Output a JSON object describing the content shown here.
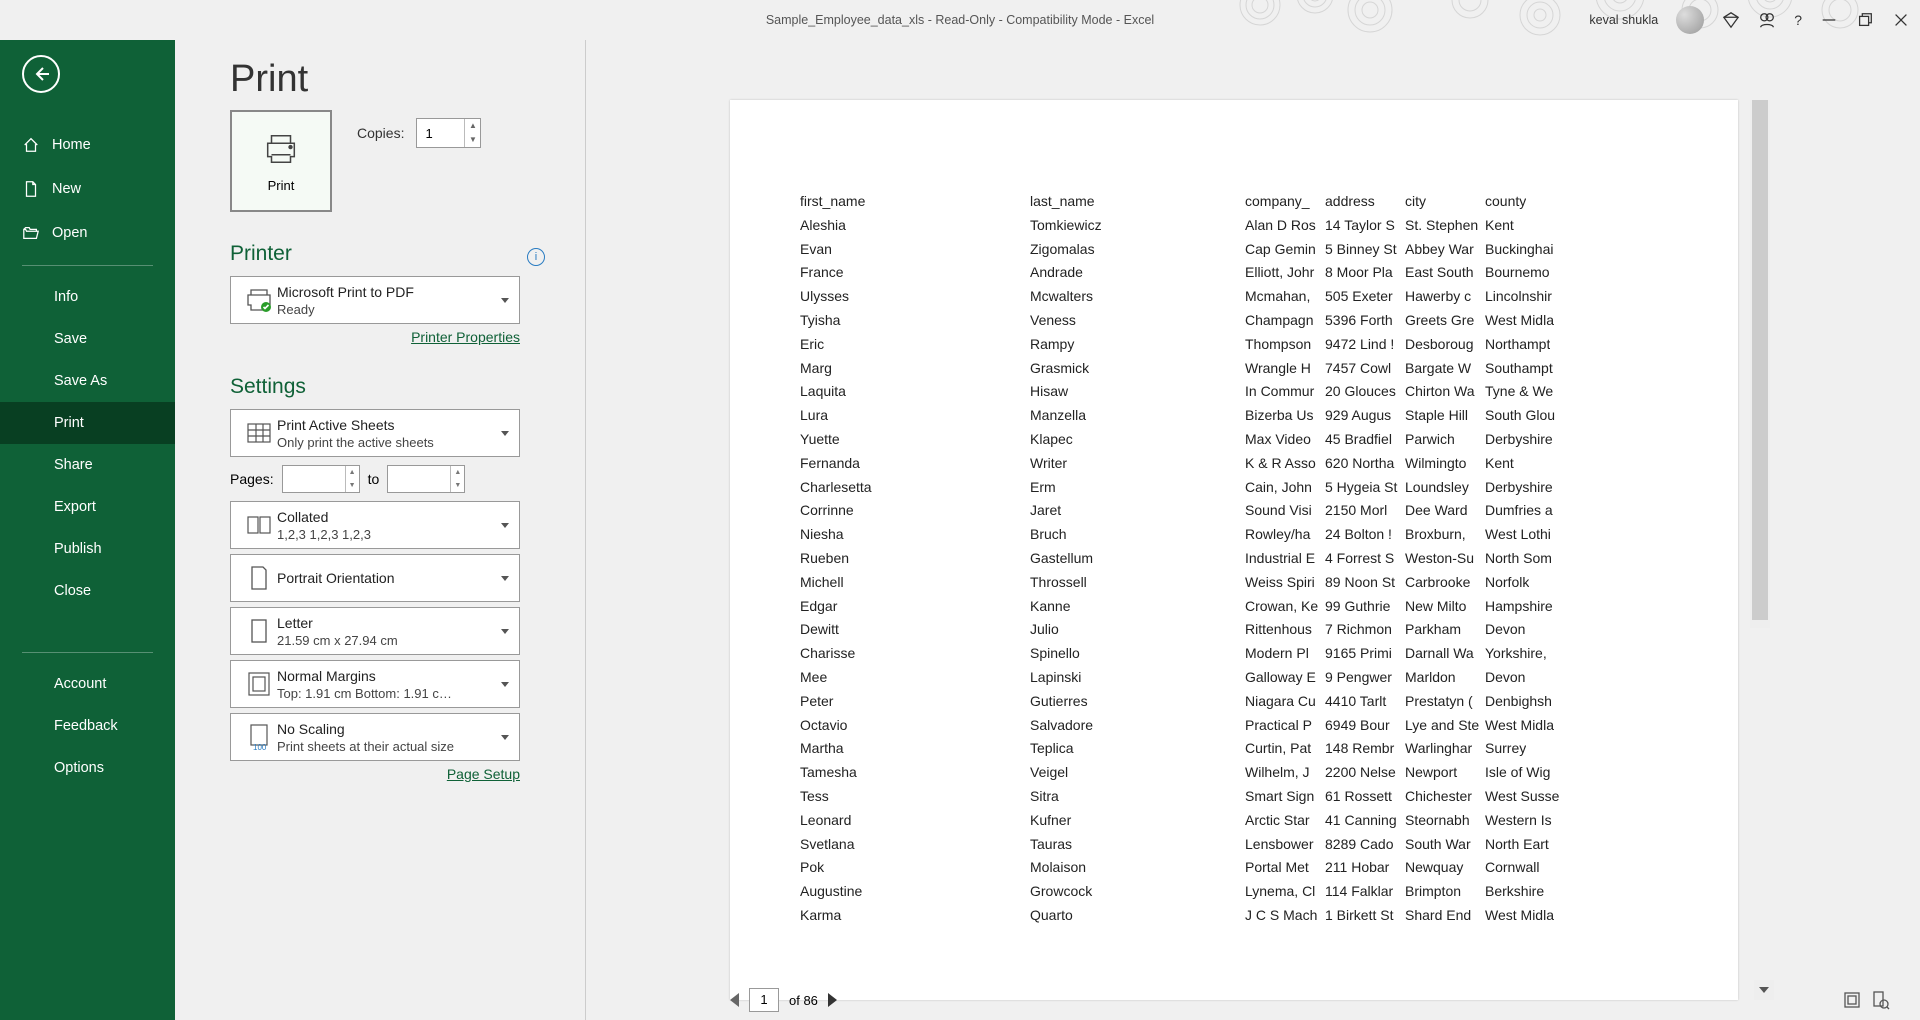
{
  "title": "Sample_Employee_data_xls  -  Read-Only  -  Compatibility Mode  -  Excel",
  "user": "keval shukla",
  "page_heading": "Print",
  "nav": {
    "home": "Home",
    "new": "New",
    "open": "Open",
    "info": "Info",
    "save": "Save",
    "saveas": "Save As",
    "print": "Print",
    "share": "Share",
    "export": "Export",
    "publish": "Publish",
    "close": "Close",
    "account": "Account",
    "feedback": "Feedback",
    "options": "Options"
  },
  "print_button": "Print",
  "copies": {
    "label": "Copies:",
    "value": "1"
  },
  "printer_heading": "Printer",
  "printer": {
    "name": "Microsoft Print to PDF",
    "status": "Ready"
  },
  "printer_props": "Printer Properties",
  "settings_heading": "Settings",
  "print_active": {
    "line1": "Print Active Sheets",
    "line2": "Only print the active sheets"
  },
  "pages": {
    "label": "Pages:",
    "to": "to"
  },
  "collated": {
    "line1": "Collated",
    "line2": "1,2,3    1,2,3    1,2,3"
  },
  "orientation": {
    "line1": "Portrait Orientation"
  },
  "paper": {
    "line1": "Letter",
    "line2": "21.59 cm x 27.94 cm"
  },
  "margins": {
    "line1": "Normal Margins",
    "line2": "Top: 1.91 cm Bottom: 1.91 c…"
  },
  "scaling": {
    "line1": "No Scaling",
    "line2": "Print sheets at their actual size"
  },
  "page_setup": "Page Setup",
  "chart_data": {
    "type": "table",
    "columns": [
      "first_name",
      "last_name",
      "company_",
      "address",
      "city",
      "county"
    ],
    "rows": [
      [
        "Aleshia",
        "Tomkiewicz",
        "Alan D Ros",
        "14 Taylor S",
        "St. Stephen",
        "Kent"
      ],
      [
        "Evan",
        "Zigomalas",
        "Cap Gemin",
        "5 Binney St",
        "Abbey War",
        "Buckinghai"
      ],
      [
        "France",
        "Andrade",
        "Elliott, Johr",
        "8 Moor Pla",
        "East South",
        "Bournemo"
      ],
      [
        "Ulysses",
        "Mcwalters",
        "Mcmahan,",
        "505 Exeter",
        "Hawerby c",
        "Lincolnshir"
      ],
      [
        "Tyisha",
        "Veness",
        "Champagn",
        "5396 Forth",
        "Greets Gre",
        "West Midla"
      ],
      [
        "Eric",
        "Rampy",
        "Thompson",
        "9472 Lind !",
        "Desboroug",
        "Northampt"
      ],
      [
        "Marg",
        "Grasmick",
        "Wrangle H",
        "7457 Cowl",
        "Bargate W",
        "Southampt"
      ],
      [
        "Laquita",
        "Hisaw",
        "In Commur",
        "20 Glouces",
        "Chirton Wa",
        "Tyne & We"
      ],
      [
        "Lura",
        "Manzella",
        "Bizerba Us",
        "929 Augus",
        "Staple Hill",
        "South Glou"
      ],
      [
        "Yuette",
        "Klapec",
        "Max Video",
        "45 Bradfiel",
        "Parwich",
        "Derbyshire"
      ],
      [
        "Fernanda",
        "Writer",
        "K & R Asso",
        "620 Northa",
        "Wilmingto",
        "Kent"
      ],
      [
        "Charlesetta",
        "Erm",
        "Cain, John",
        "5 Hygeia St",
        "Loundsley",
        "Derbyshire"
      ],
      [
        "Corrinne",
        "Jaret",
        "Sound Visi",
        "2150 Morl",
        "Dee Ward",
        "Dumfries a"
      ],
      [
        "Niesha",
        "Bruch",
        "Rowley/ha",
        "24 Bolton !",
        "Broxburn,",
        "West Lothi"
      ],
      [
        "Rueben",
        "Gastellum",
        "Industrial E",
        "4 Forrest S",
        "Weston-Su",
        "North Som"
      ],
      [
        "Michell",
        "Throssell",
        "Weiss Spiri",
        "89 Noon St",
        "Carbrooke",
        "Norfolk"
      ],
      [
        "Edgar",
        "Kanne",
        "Crowan, Ke",
        "99 Guthrie",
        "New Milto",
        "Hampshire"
      ],
      [
        "Dewitt",
        "Julio",
        "Rittenhous",
        "7 Richmon",
        "Parkham",
        "Devon"
      ],
      [
        "Charisse",
        "Spinello",
        "Modern Pl",
        "9165 Primi",
        "Darnall Wa",
        "Yorkshire,"
      ],
      [
        "Mee",
        "Lapinski",
        "Galloway E",
        "9 Pengwer",
        "Marldon",
        "Devon"
      ],
      [
        "Peter",
        "Gutierres",
        "Niagara Cu",
        "4410 Tarlt",
        "Prestatyn (",
        "Denbighsh"
      ],
      [
        "Octavio",
        "Salvadore",
        "Practical P",
        "6949 Bour",
        "Lye and Ste",
        "West Midla"
      ],
      [
        "Martha",
        "Teplica",
        "Curtin, Pat",
        "148 Rembr",
        "Warlinghar",
        "Surrey"
      ],
      [
        "Tamesha",
        "Veigel",
        "Wilhelm, J",
        "2200 Nelse",
        "Newport",
        "Isle of Wig"
      ],
      [
        "Tess",
        "Sitra",
        "Smart Sign",
        "61 Rossett",
        "Chichester",
        "West Susse"
      ],
      [
        "Leonard",
        "Kufner",
        "Arctic Star",
        "41 Canning",
        "Steornabh",
        "Western Is"
      ],
      [
        "Svetlana",
        "Tauras",
        "Lensbower",
        "8289 Cado",
        "South War",
        "North Eart"
      ],
      [
        "Pok",
        "Molaison",
        "Portal Met",
        "211 Hobar",
        "Newquay",
        "Cornwall"
      ],
      [
        "Augustine",
        "Growcock",
        "Lynema, Cl",
        "114 Falklar",
        "Brimpton",
        "Berkshire"
      ],
      [
        "Karma",
        "Quarto",
        "J C S Mach",
        "1 Birkett St",
        "Shard End",
        "West Midla"
      ]
    ]
  },
  "page_nav": {
    "current": "1",
    "total": "of 86"
  }
}
